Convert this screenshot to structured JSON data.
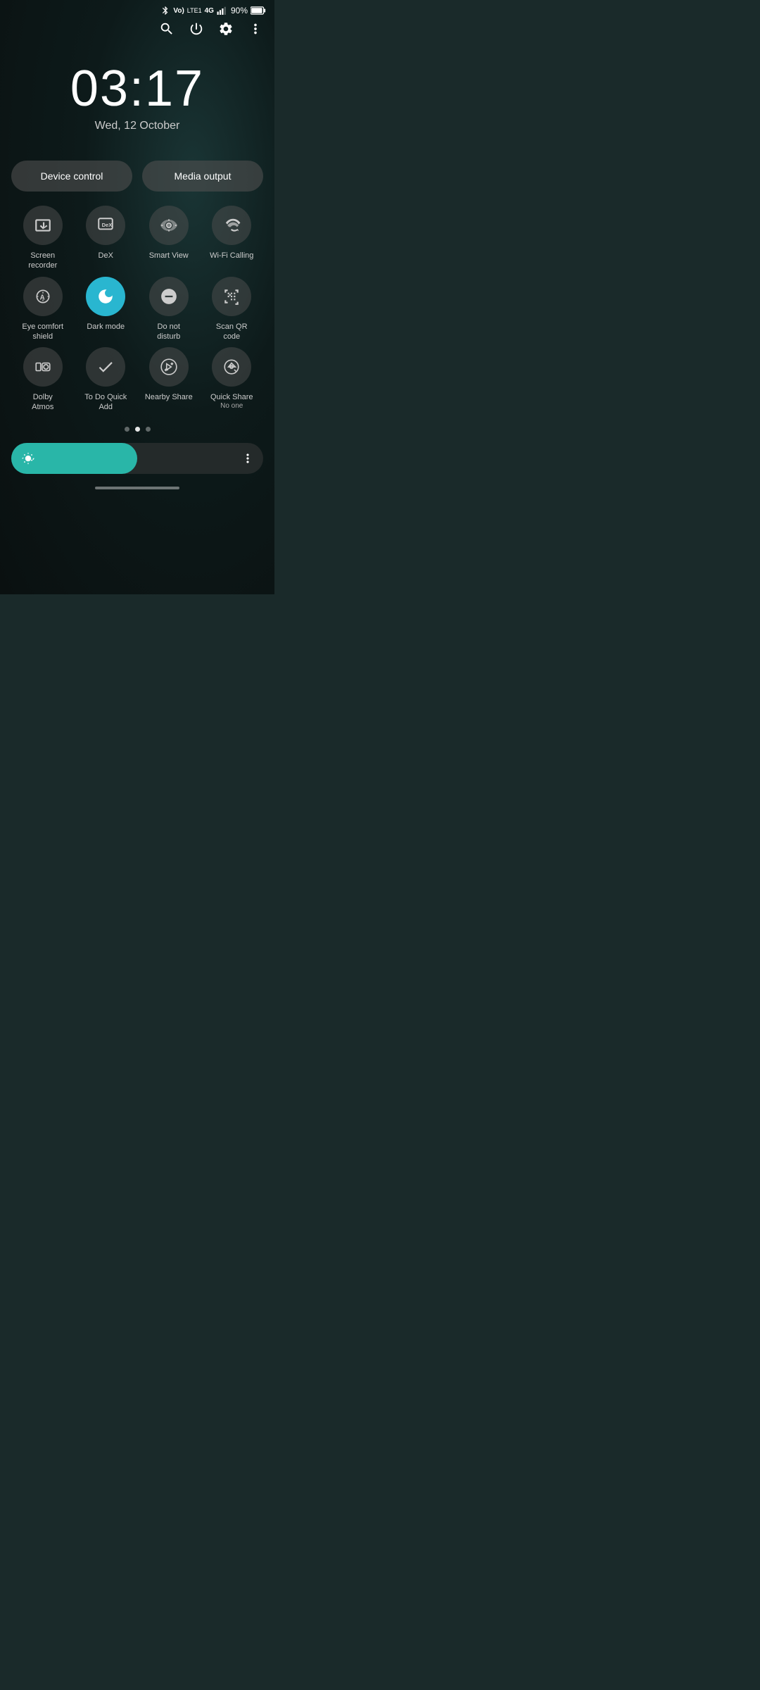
{
  "statusBar": {
    "battery": "90%",
    "icons": [
      "bluetooth",
      "volte-lte1",
      "4g",
      "signal",
      "battery"
    ]
  },
  "topControls": {
    "search_label": "Search",
    "power_label": "Power",
    "settings_label": "Settings",
    "more_label": "More options"
  },
  "clock": {
    "time": "03:17",
    "date": "Wed, 12 October"
  },
  "actionButtons": {
    "device_control": "Device control",
    "media_output": "Media output"
  },
  "quickSettings": {
    "row1": [
      {
        "id": "screen-recorder",
        "label": "Screen\nrecorder",
        "active": false
      },
      {
        "id": "dex",
        "label": "DeX",
        "active": false
      },
      {
        "id": "smart-view",
        "label": "Smart View",
        "active": false
      },
      {
        "id": "wifi-calling",
        "label": "Wi-Fi Calling",
        "active": false
      }
    ],
    "row2": [
      {
        "id": "eye-comfort",
        "label": "Eye comfort\nshield",
        "sublabel": "",
        "active": false
      },
      {
        "id": "dark-mode",
        "label": "Dark mode",
        "sublabel": "",
        "active": true
      },
      {
        "id": "do-not-disturb",
        "label": "Do not\ndisturb",
        "sublabel": "",
        "active": false
      },
      {
        "id": "scan-qr",
        "label": "Scan QR\ncode",
        "sublabel": "",
        "active": false
      }
    ],
    "row3": [
      {
        "id": "dolby-atmos",
        "label": "Dolby\nAtmos",
        "sublabel": "",
        "active": false
      },
      {
        "id": "todo-quick-add",
        "label": "To Do Quick\nAdd",
        "sublabel": "",
        "active": false
      },
      {
        "id": "nearby-share",
        "label": "Nearby Share",
        "sublabel": "",
        "active": false
      },
      {
        "id": "quick-share",
        "label": "Quick Share",
        "sublabel": "No one",
        "active": false
      }
    ]
  },
  "pagination": {
    "total": 3,
    "active": 1
  },
  "brightness": {
    "level": 50,
    "icon": "brightness"
  }
}
